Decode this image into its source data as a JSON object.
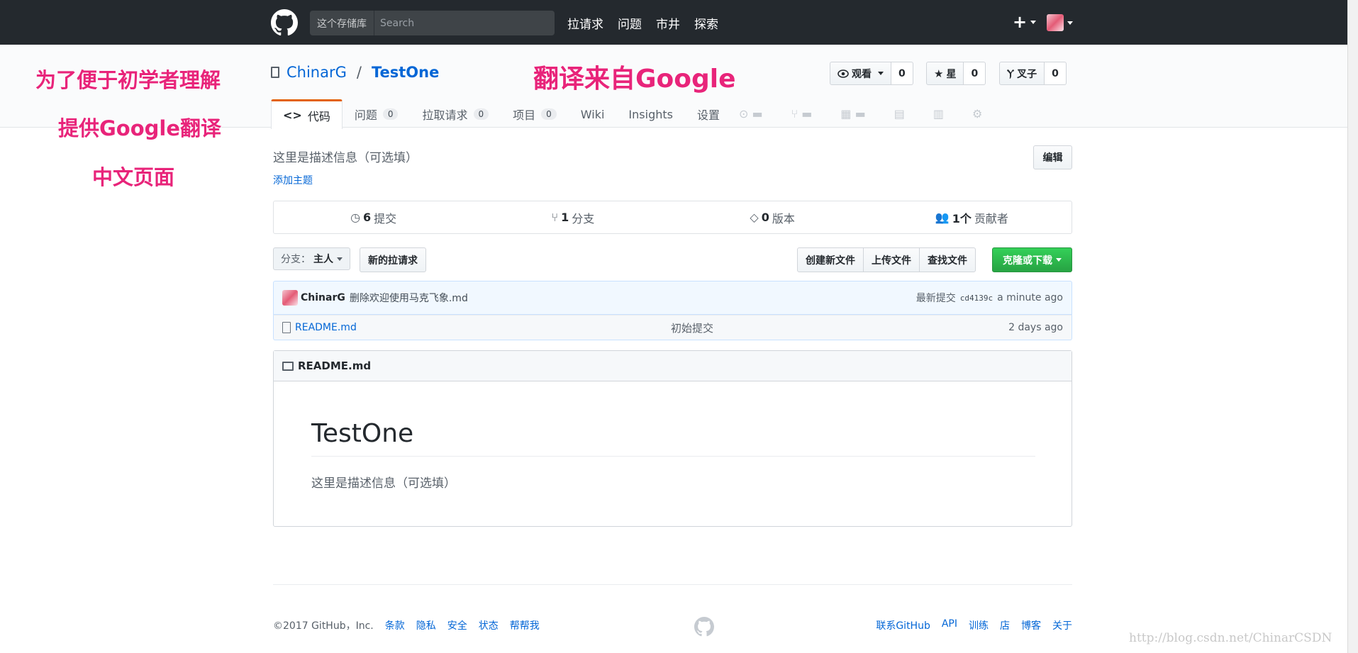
{
  "header": {
    "search_scope": "这个存储库",
    "search_placeholder": "Search",
    "nav": [
      "拉请求",
      "问题",
      "市井",
      "探索"
    ],
    "plus": "+"
  },
  "repo": {
    "owner": "ChinarG",
    "separator": "/",
    "name": "TestOne",
    "watch": {
      "label": "观看",
      "count": "0"
    },
    "star": {
      "label": "星",
      "count": "0"
    },
    "fork": {
      "label": "叉子",
      "count": "0"
    }
  },
  "tabs": {
    "code": "代码",
    "issues": {
      "label": "问题",
      "count": "0"
    },
    "pulls": {
      "label": "拉取请求",
      "count": "0"
    },
    "projects": {
      "label": "项目",
      "count": "0"
    },
    "wiki": "Wiki",
    "insights": "Insights",
    "settings": "设置"
  },
  "main": {
    "description": "这里是描述信息（可选填）",
    "add_topics": "添加主题",
    "edit": "编辑"
  },
  "summary": {
    "commits": {
      "num": "6",
      "label": "提交"
    },
    "branches": {
      "num": "1",
      "label": "分支"
    },
    "releases": {
      "num": "0",
      "label": "版本"
    },
    "contributors": {
      "num": "1个",
      "label": "贡献者"
    }
  },
  "toolbar": {
    "branch_label": "分支：",
    "branch_value": "主人",
    "new_pr": "新的拉请求",
    "create_file": "创建新文件",
    "upload": "上传文件",
    "find": "查找文件",
    "clone": "克隆或下载"
  },
  "commit": {
    "author": "ChinarG",
    "message": "删除欢迎使用马克飞象.md",
    "latest_label": "最新提交",
    "sha": "cd4139c",
    "age": "a minute ago"
  },
  "files": [
    {
      "name": "README.md",
      "message": "初始提交",
      "age": "2 days ago"
    }
  ],
  "readme": {
    "header": "README.md",
    "h1": "TestOne",
    "paragraph": "这里是描述信息（可选填）"
  },
  "footer": {
    "copyright": "©2017 GitHub，Inc.",
    "left_links": [
      "条款",
      "隐私",
      "安全",
      "状态",
      "帮帮我"
    ],
    "right_links": [
      "联系GitHub",
      "API",
      "训练",
      "店",
      "博客",
      "关于"
    ]
  },
  "annotations": {
    "line1": "为了便于初学者理解",
    "line2": "提供Google翻译",
    "line3": "中文页面",
    "translated": "翻译来自Google"
  },
  "watermark": "http://blog.csdn.net/ChinarCSDN",
  "colors": {
    "header_bg": "#24292e",
    "link": "#0366d6",
    "tab_accent": "#e36209",
    "clone_green": "#28a745",
    "annotation_pink": "#e8247a"
  }
}
